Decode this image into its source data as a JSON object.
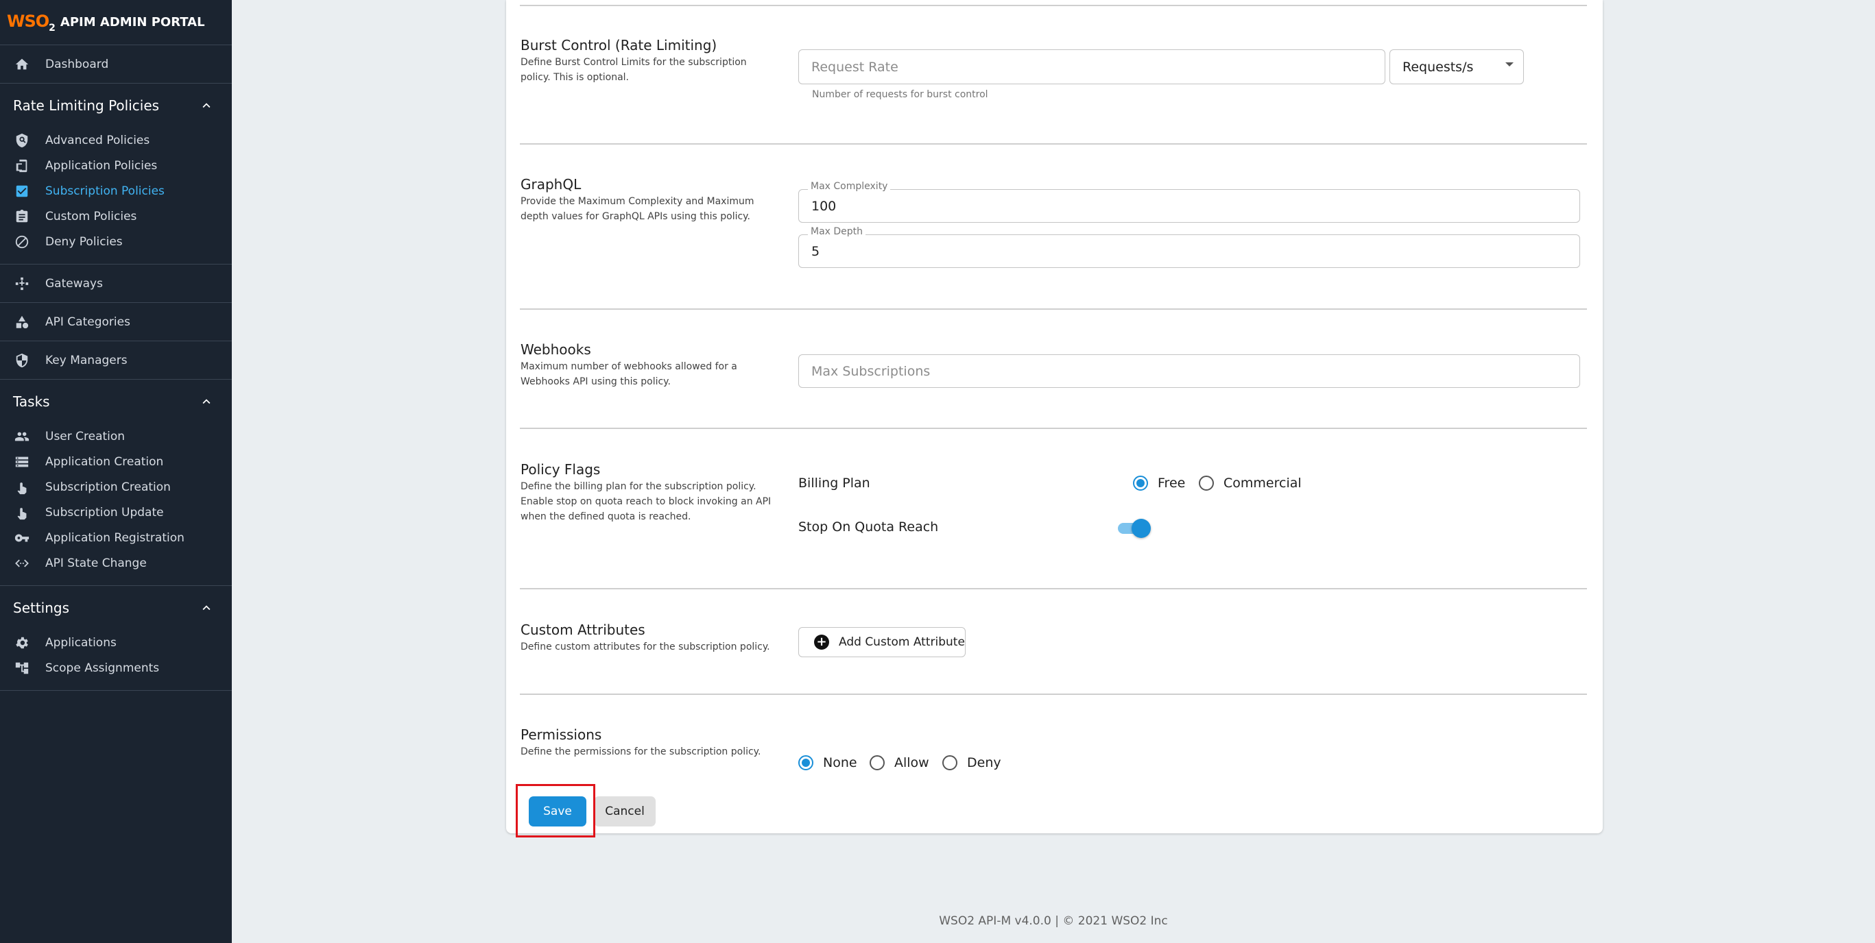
{
  "brand": {
    "logo": "WSO",
    "logo_sub": "2",
    "title": "APIM ADMIN PORTAL"
  },
  "sidebar": {
    "dashboard": "Dashboard",
    "rate_limiting": {
      "title": "Rate Limiting Policies",
      "items": [
        {
          "label": "Advanced Policies",
          "icon": "shield-search-icon"
        },
        {
          "label": "Application Policies",
          "icon": "app-icon"
        },
        {
          "label": "Subscription Policies",
          "icon": "checkbox-icon",
          "active": true
        },
        {
          "label": "Custom Policies",
          "icon": "clipboard-icon"
        },
        {
          "label": "Deny Policies",
          "icon": "block-icon"
        }
      ]
    },
    "gateways": "Gateways",
    "api_categories": "API Categories",
    "key_managers": "Key Managers",
    "tasks": {
      "title": "Tasks",
      "items": [
        {
          "label": "User Creation",
          "icon": "people-icon"
        },
        {
          "label": "Application Creation",
          "icon": "storage-icon"
        },
        {
          "label": "Subscription Creation",
          "icon": "touch-icon"
        },
        {
          "label": "Subscription Update",
          "icon": "touch-icon"
        },
        {
          "label": "Application Registration",
          "icon": "key-icon"
        },
        {
          "label": "API State Change",
          "icon": "code-icon"
        }
      ]
    },
    "settings": {
      "title": "Settings",
      "items": [
        {
          "label": "Applications",
          "icon": "gear-icon"
        },
        {
          "label": "Scope Assignments",
          "icon": "tree-icon"
        }
      ]
    }
  },
  "burst": {
    "title": "Burst Control (Rate Limiting)",
    "desc": "Define Burst Control Limits for the subscription policy. This is optional.",
    "rate_placeholder": "Request Rate",
    "unit": "Requests/s",
    "helper": "Number of requests for burst control"
  },
  "graphql": {
    "title": "GraphQL",
    "desc": "Provide the Maximum Complexity and Maximum depth values for GraphQL APIs using this policy.",
    "complexity_label": "Max Complexity",
    "complexity_value": "100",
    "depth_label": "Max Depth",
    "depth_value": "5"
  },
  "webhooks": {
    "title": "Webhooks",
    "desc": "Maximum number of webhooks allowed for a Webhooks API using this policy.",
    "placeholder": "Max Subscriptions"
  },
  "flags": {
    "title": "Policy Flags",
    "desc": "Define the billing plan for the subscription policy. Enable stop on quota reach to block invoking an API when the defined quota is reached.",
    "billing_label": "Billing Plan",
    "billing_options": [
      "Free",
      "Commercial"
    ],
    "billing_selected": "Free",
    "stop_label": "Stop On Quota Reach",
    "stop_on": true
  },
  "custom_attrs": {
    "title": "Custom Attributes",
    "desc": "Define custom attributes for the subscription policy.",
    "add_button": "Add Custom Attribute"
  },
  "permissions": {
    "title": "Permissions",
    "desc": "Define the permissions for the subscription policy.",
    "options": [
      "None",
      "Allow",
      "Deny"
    ],
    "selected": "None"
  },
  "actions": {
    "save": "Save",
    "cancel": "Cancel"
  },
  "footer": "WSO2 API-M v4.0.0 | © 2021 WSO2 Inc",
  "colors": {
    "sidebar_bg": "#1b2430",
    "accent": "#1a8fd8",
    "active_nav": "#41b3f2",
    "highlight": "#e0141b"
  }
}
